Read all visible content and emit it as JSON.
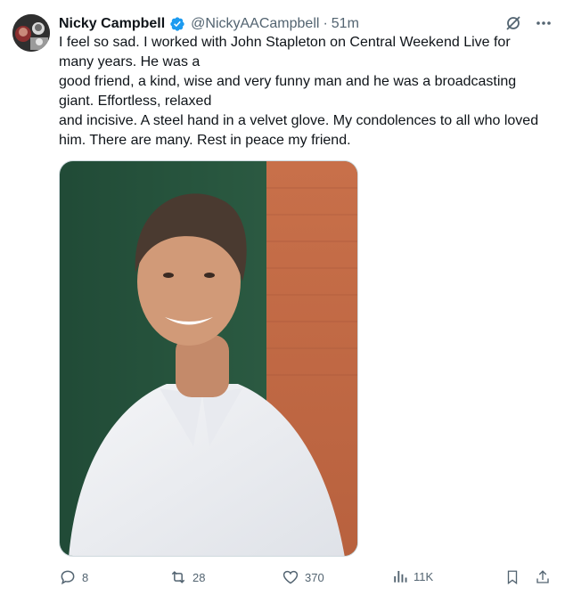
{
  "author": {
    "name": "Nicky Campbell",
    "handle": "@NickyAACampbell",
    "separator": "·",
    "time": "51m"
  },
  "tweet": {
    "lines": [
      "I feel so sad. I worked with John Stapleton on Central Weekend Live for",
      "many years. He was a",
      "good friend, a kind, wise and very funny man and he was a broadcasting",
      "giant. Effortless, relaxed",
      "and incisive. A steel hand in a velvet glove. My condolences to all who loved",
      "him. There are many. Rest in peace my friend."
    ]
  },
  "media": {
    "icon": "portrait-photo"
  },
  "actions": {
    "replies": "8",
    "reposts": "28",
    "likes": "370",
    "views": "11K"
  },
  "colors": {
    "text": "#0f1419",
    "secondary": "#536471",
    "verified": "#1d9bf0"
  }
}
